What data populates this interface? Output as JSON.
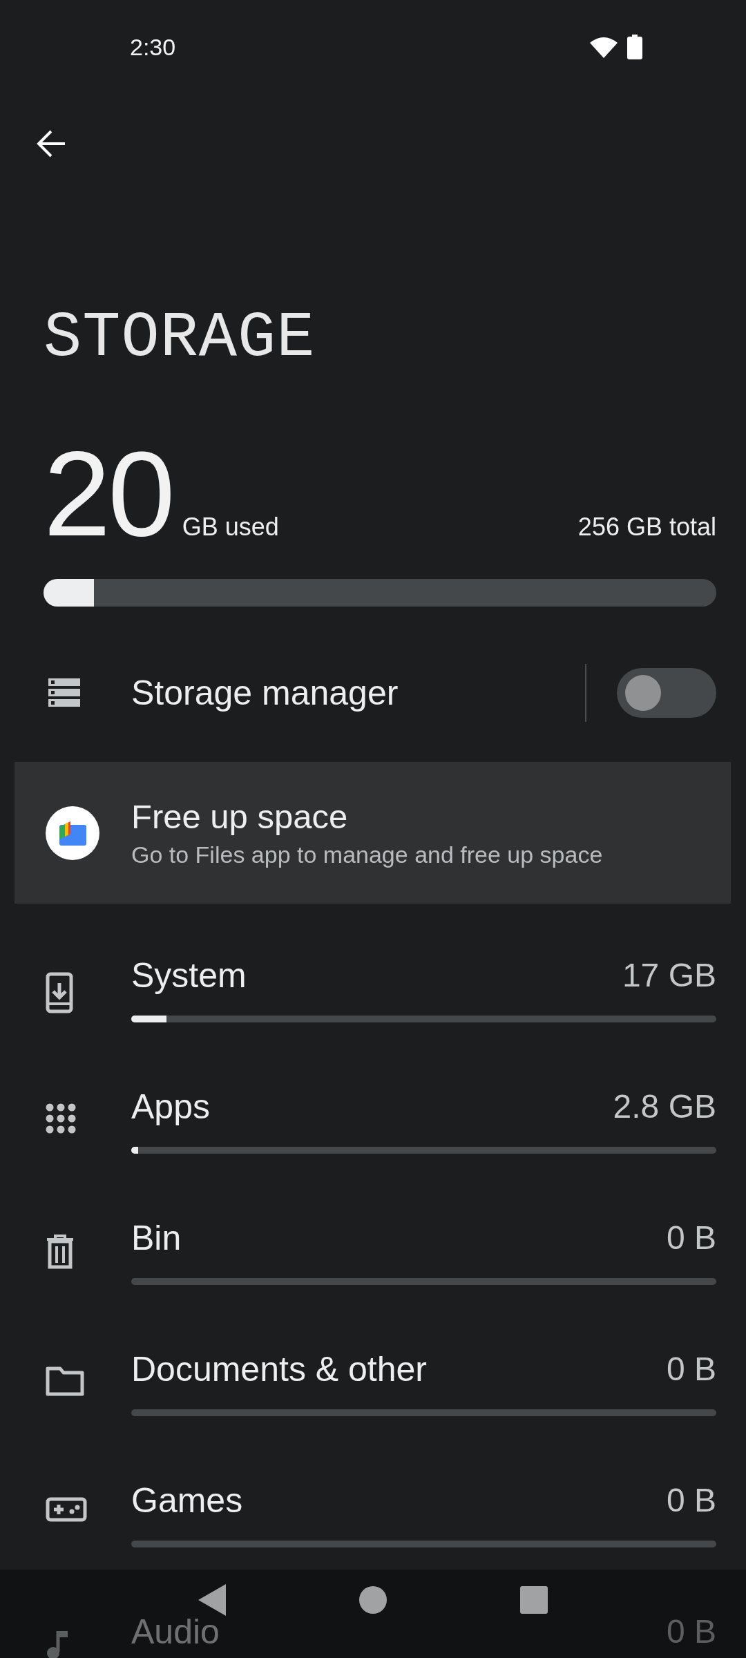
{
  "status_bar": {
    "time": "2:30"
  },
  "title": "STORAGE",
  "usage": {
    "used_amount": "20",
    "used_unit": "GB used",
    "total": "256 GB total",
    "level": 0.075
  },
  "storage_manager": {
    "label": "Storage manager",
    "on": false
  },
  "free_up_space": {
    "title": "Free up space",
    "subtitle": "Go to Files app to manage and free up space"
  },
  "categories": [
    {
      "name": "System",
      "size": "17 GB",
      "level": 0.06
    },
    {
      "name": "Apps",
      "size": "2.8 GB",
      "level": 0.012
    },
    {
      "name": "Bin",
      "size": "0 B"
    },
    {
      "name": "Documents & other",
      "size": "0 B"
    },
    {
      "name": "Games",
      "size": "0 B"
    },
    {
      "name": "Audio",
      "size": "0 B"
    }
  ]
}
